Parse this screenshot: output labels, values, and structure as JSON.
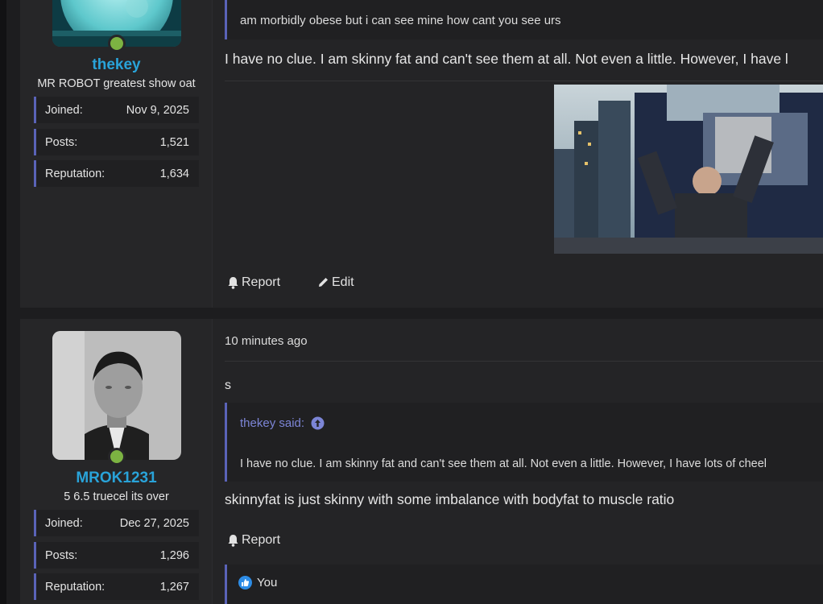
{
  "posts": [
    {
      "user": {
        "name": "thekey",
        "title": "MR ROBOT greatest show oat",
        "joined_label": "Joined:",
        "joined": "Nov 9, 2025",
        "posts_label": "Posts:",
        "posts": "1,521",
        "reputation_label": "Reputation:",
        "reputation": "1,634"
      },
      "quote_text": "am morbidly obese but i can see mine how cant you see urs",
      "message": "I have no clue. I am skinny fat and can't see them at all. Not even a little. However, I have l",
      "actions": {
        "report": "Report",
        "edit": "Edit"
      }
    },
    {
      "time": "10 minutes ago",
      "user": {
        "name": "MROK1231",
        "title": "5 6.5 truecel its over",
        "joined_label": "Joined:",
        "joined": "Dec 27, 2025",
        "posts_label": "Posts:",
        "posts": "1,296",
        "reputation_label": "Reputation:",
        "reputation": "1,267"
      },
      "intro": "s",
      "quote_author": "thekey said:",
      "quote_text": "I have no clue. I am skinny fat and can't see them at all. Not even a little. However, I have lots of cheel",
      "message": "skinnyfat is just skinny with some imbalance with bodyfat to muscle ratio",
      "actions": {
        "report": "Report"
      },
      "reaction": "You"
    }
  ],
  "colors": {
    "accent": "#5a63b8",
    "username": "#29a3d9",
    "online": "#7cb342",
    "like": "#2d8ce6"
  }
}
